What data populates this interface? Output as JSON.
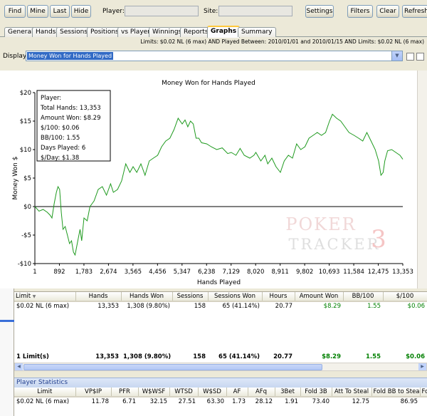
{
  "toolbar": {
    "find": "Find",
    "mine": "Mine",
    "last": "Last",
    "hide": "Hide",
    "player_label": "Player:",
    "site_label": "Site:",
    "settings": "Settings",
    "filters": "Filters",
    "clear": "Clear",
    "refresh": "Refresh"
  },
  "tabs": [
    "General",
    "Hands",
    "Sessions",
    "Positions",
    "vs Player",
    "Winnings",
    "Reports",
    "Graphs",
    "Summary"
  ],
  "active_tab": "Graphs",
  "limits_text": "Limits: $0.02 NL (6 max) AND Played Between: 2010/01/01 and 2010/01/15 AND Limits: $0.02 NL (6 max)",
  "display": {
    "label": "Display:",
    "value": "Money Won for Hands Played"
  },
  "chart_data": {
    "type": "line",
    "title": "Money Won for Hands Played",
    "xlabel": "Hands Played",
    "ylabel": "Money Won $",
    "xlim": [
      1,
      13353
    ],
    "ylim": [
      -10,
      20
    ],
    "xticks": [
      "1",
      "892",
      "1,783",
      "2,674",
      "3,565",
      "4,456",
      "5,347",
      "6,238",
      "7,129",
      "8,020",
      "8,911",
      "9,802",
      "10,693",
      "11,584",
      "12,475",
      "13,353"
    ],
    "yticks": [
      "$20",
      "$15",
      "$10",
      "$5",
      "$0",
      "-$5",
      "-$10"
    ],
    "series_color": "#1f9a1f",
    "points": [
      [
        1,
        0
      ],
      [
        150,
        -0.8
      ],
      [
        300,
        -0.5
      ],
      [
        450,
        -1
      ],
      [
        550,
        -1.5
      ],
      [
        620,
        -2
      ],
      [
        700,
        0.5
      ],
      [
        780,
        2.5
      ],
      [
        840,
        3.5
      ],
      [
        900,
        3
      ],
      [
        960,
        -1
      ],
      [
        1020,
        -4
      ],
      [
        1100,
        -3.5
      ],
      [
        1180,
        -5
      ],
      [
        1260,
        -6.5
      ],
      [
        1330,
        -6
      ],
      [
        1400,
        -8
      ],
      [
        1460,
        -8.5
      ],
      [
        1520,
        -7
      ],
      [
        1580,
        -5.5
      ],
      [
        1640,
        -4
      ],
      [
        1700,
        -6
      ],
      [
        1783,
        -2
      ],
      [
        1900,
        -2.5
      ],
      [
        2000,
        0
      ],
      [
        2150,
        1
      ],
      [
        2300,
        3
      ],
      [
        2450,
        3.5
      ],
      [
        2600,
        2
      ],
      [
        2750,
        4
      ],
      [
        2850,
        2.5
      ],
      [
        3000,
        3
      ],
      [
        3150,
        4.5
      ],
      [
        3300,
        7.5
      ],
      [
        3450,
        6
      ],
      [
        3565,
        7
      ],
      [
        3700,
        6
      ],
      [
        3850,
        7.5
      ],
      [
        4000,
        5.5
      ],
      [
        4150,
        8
      ],
      [
        4300,
        8.5
      ],
      [
        4456,
        9
      ],
      [
        4600,
        10.5
      ],
      [
        4750,
        11.5
      ],
      [
        4900,
        12
      ],
      [
        5050,
        13.5
      ],
      [
        5200,
        15.5
      ],
      [
        5347,
        14.5
      ],
      [
        5450,
        15.2
      ],
      [
        5550,
        14
      ],
      [
        5650,
        15
      ],
      [
        5750,
        14.5
      ],
      [
        5850,
        12
      ],
      [
        5950,
        12
      ],
      [
        6050,
        11.2
      ],
      [
        6238,
        11
      ],
      [
        6400,
        10.5
      ],
      [
        6600,
        10
      ],
      [
        6800,
        10.3
      ],
      [
        7000,
        9.3
      ],
      [
        7129,
        9.5
      ],
      [
        7300,
        9
      ],
      [
        7450,
        10.2
      ],
      [
        7600,
        9
      ],
      [
        7800,
        8.5
      ],
      [
        7950,
        9
      ],
      [
        8020,
        9.5
      ],
      [
        8200,
        8
      ],
      [
        8350,
        9
      ],
      [
        8450,
        7.5
      ],
      [
        8600,
        8.5
      ],
      [
        8750,
        7
      ],
      [
        8911,
        6
      ],
      [
        9050,
        8
      ],
      [
        9200,
        9
      ],
      [
        9350,
        8.5
      ],
      [
        9500,
        11
      ],
      [
        9650,
        10
      ],
      [
        9802,
        10.5
      ],
      [
        9950,
        12
      ],
      [
        10100,
        12.5
      ],
      [
        10250,
        13
      ],
      [
        10400,
        12.5
      ],
      [
        10550,
        13
      ],
      [
        10693,
        15
      ],
      [
        10800,
        16.2
      ],
      [
        10950,
        15.5
      ],
      [
        11100,
        15
      ],
      [
        11250,
        14
      ],
      [
        11400,
        13
      ],
      [
        11584,
        12.5
      ],
      [
        11750,
        12
      ],
      [
        11900,
        11.5
      ],
      [
        12050,
        13
      ],
      [
        12200,
        11.5
      ],
      [
        12350,
        10
      ],
      [
        12475,
        8
      ],
      [
        12560,
        5.5
      ],
      [
        12640,
        6
      ],
      [
        12700,
        8
      ],
      [
        12800,
        9.8
      ],
      [
        12950,
        10
      ],
      [
        13100,
        9.5
      ],
      [
        13250,
        9
      ],
      [
        13353,
        8.3
      ]
    ],
    "tooltip": {
      "title": "Player:",
      "lines": [
        "Total Hands: 13,353",
        "Amount Won: $8.29",
        "$/100: $0.06",
        "BB/100: 1.55",
        "Days Played: 6",
        "$/Day: $1.38"
      ]
    },
    "watermark": [
      "POKER",
      "TRACKER"
    ],
    "watermark_digit": "3"
  },
  "limits_grid": {
    "columns": [
      "Limit",
      "Hands",
      "Hands Won",
      "Sessions",
      "Sessions Won",
      "Hours",
      "Amount Won",
      "BB/100",
      "$/100"
    ],
    "rows": [
      [
        "$0.02 NL (6 max)",
        "13,353",
        "1,308 (9.80%)",
        "158",
        "65 (41.14%)",
        "20.77",
        "$8.29",
        "1.55",
        "$0.06"
      ]
    ],
    "total": [
      "1 Limit(s)",
      "13,353",
      "1,308 (9.80%)",
      "158",
      "65 (41.14%)",
      "20.77",
      "$8.29",
      "1.55",
      "$0.06"
    ]
  },
  "player_stats": {
    "title": "Player Statistics",
    "columns": [
      "Limit",
      "VP$IP",
      "PFR",
      "W$WSF",
      "WTSD",
      "W$SD",
      "AF",
      "AFq",
      "3Bet",
      "Fold 3B",
      "Att To Steal",
      "Fold BB to Steal",
      "Fold S"
    ],
    "rows": [
      [
        "$0.02 NL (6 max)",
        "11.78",
        "6.71",
        "32.15",
        "27.51",
        "63.30",
        "1.73",
        "28.12",
        "1.91",
        "73.40",
        "12.75",
        "86.95",
        ""
      ]
    ]
  }
}
